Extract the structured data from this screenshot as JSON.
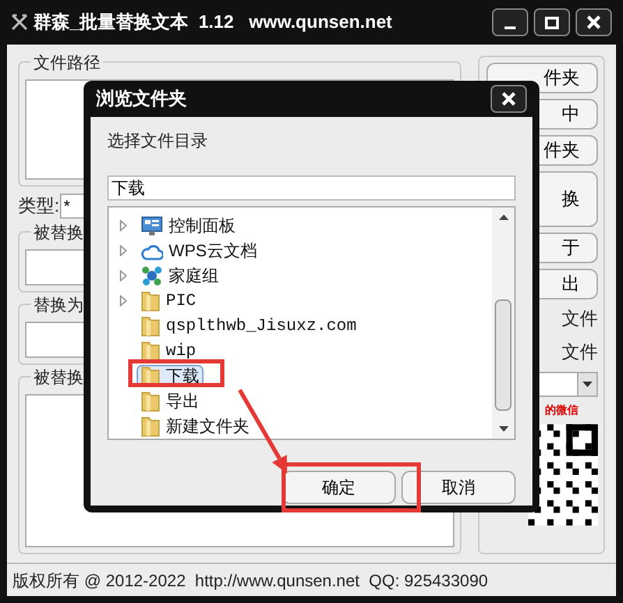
{
  "window": {
    "title": "群森_批量替换文本  1.12   www.qunsen.net"
  },
  "path_group": {
    "label": "文件路径"
  },
  "type_field": {
    "label": "类型:",
    "value": "*"
  },
  "groups": [
    {
      "label": "被替换"
    },
    {
      "label": "替换为"
    },
    {
      "label": "被替换"
    }
  ],
  "side_buttons": [
    {
      "label": "件夹",
      "kind": "small"
    },
    {
      "label": "中",
      "kind": "small"
    },
    {
      "label": "件夹",
      "kind": "small"
    },
    {
      "label": "换",
      "kind": "tall"
    },
    {
      "label": "于",
      "kind": "small"
    },
    {
      "label": "出",
      "kind": "small"
    }
  ],
  "side_labels": [
    "文件",
    "文件"
  ],
  "qr_caption": "的微信",
  "status_bar": "版权所有 @ 2012-2022  http://www.qunsen.net  QQ: 925433090",
  "dialog": {
    "title": "浏览文件夹",
    "prompt": "选择文件目录",
    "path_value": "下载",
    "tree": [
      {
        "label": "控制面板",
        "kind": "panel",
        "expandable": true,
        "selected": false
      },
      {
        "label": "WPS云文档",
        "kind": "cloud",
        "expandable": true,
        "selected": false
      },
      {
        "label": "家庭组",
        "kind": "homegroup",
        "expandable": true,
        "selected": false
      },
      {
        "label": "PIC",
        "kind": "folder",
        "expandable": true,
        "selected": false
      },
      {
        "label": "qsplthwb_Jisuxz.com",
        "kind": "folder",
        "expandable": false,
        "selected": false
      },
      {
        "label": "wip",
        "kind": "folder",
        "expandable": false,
        "selected": false
      },
      {
        "label": "下载",
        "kind": "folder",
        "expandable": false,
        "selected": true
      },
      {
        "label": "导出",
        "kind": "folder",
        "expandable": false,
        "selected": false
      },
      {
        "label": "新建文件夹",
        "kind": "folder",
        "expandable": false,
        "selected": false
      }
    ],
    "buttons": [
      "确定",
      "取消"
    ]
  }
}
